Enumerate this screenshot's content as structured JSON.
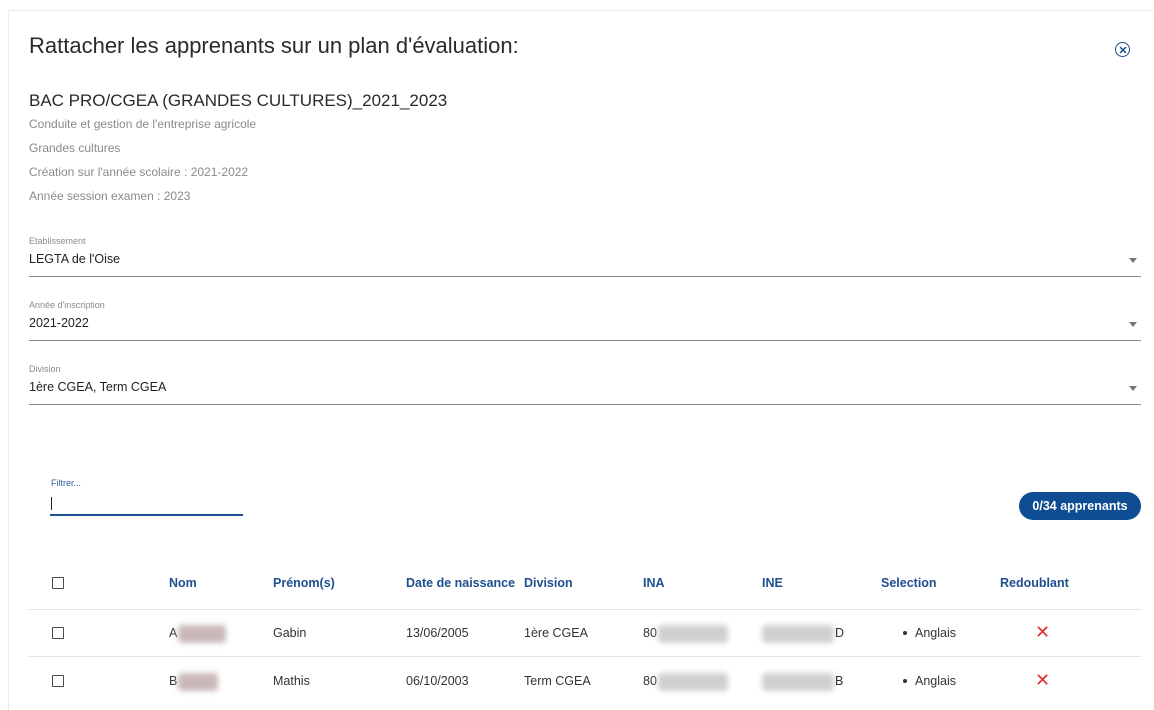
{
  "dialog": {
    "title": "Rattacher les apprenants sur un plan d'évaluation:",
    "close_icon": "close-circle-icon"
  },
  "plan": {
    "name": "BAC PRO/CGEA (GRANDES CULTURES)_2021_2023",
    "lines": [
      "Conduite et gestion de l'entreprise agricole",
      "Grandes cultures",
      "Création sur l'année scolaire : 2021-2022",
      "Année session examen : 2023"
    ]
  },
  "fields": {
    "etablissement": {
      "label": "Etablissement",
      "value": "LEGTA de l'Oise"
    },
    "annee": {
      "label": "Année d'inscription",
      "value": "2021-2022"
    },
    "division": {
      "label": "Division",
      "value": "1ère CGEA, Term CGEA"
    }
  },
  "filter": {
    "label": "Filtrer...",
    "value": ""
  },
  "count_badge": "0/34 apprenants",
  "table": {
    "headers": {
      "nom": "Nom",
      "prenom": "Prénom(s)",
      "naissance": "Date de naissance",
      "division": "Division",
      "ina": "INA",
      "ine": "INE",
      "selection": "Selection",
      "redoublant": "Redoublant"
    },
    "rows": [
      {
        "nom": "A",
        "prenom": "Gabin",
        "naissance": "13/06/2005",
        "division": "1ère CGEA",
        "ina": "80",
        "ine_suffix": "D",
        "selection": "Anglais",
        "redoublant": "✕"
      },
      {
        "nom": "B",
        "prenom": "Mathis",
        "naissance": "06/10/2003",
        "division": "Term CGEA",
        "ina": "80",
        "ine_suffix": "B",
        "selection": "Anglais",
        "redoublant": "✕"
      }
    ]
  },
  "colors": {
    "accent": "#0f4d92",
    "header_text": "#1e4f8f",
    "redoublant_no": "#e0322e"
  }
}
